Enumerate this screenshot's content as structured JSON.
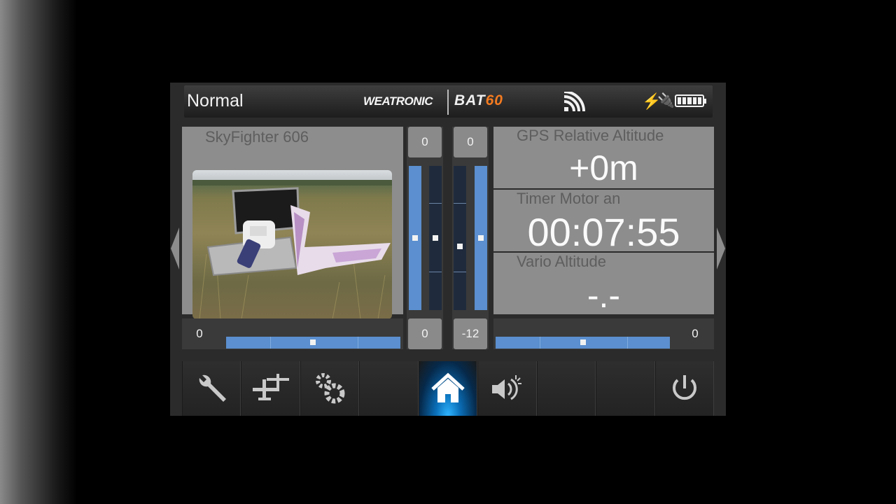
{
  "header": {
    "mode": "Normal",
    "brand": "WEATRONIC",
    "model_prefix": "BAT",
    "model_suffix": "60",
    "icons": [
      "signal-icon",
      "flash-icon",
      "plug-icon",
      "battery-icon"
    ]
  },
  "model": {
    "name": "SkyFighter 606"
  },
  "trims": {
    "col1_top": "0",
    "col2_top": "0",
    "bottom_left": "0",
    "bottom_mid_left": "0",
    "bottom_mid_right": "-12",
    "bottom_right": "0"
  },
  "telemetry": [
    {
      "label": "GPS Relative Altitude",
      "value": "+0m"
    },
    {
      "label": "Timer Motor an",
      "value": "00:07:55"
    },
    {
      "label": "Vario Altitude",
      "value": "-.-"
    }
  ],
  "nav": {
    "items": [
      "wrench-icon",
      "airplanes-icon",
      "gears-icon",
      "blank",
      "home-icon",
      "speaker-icon",
      "blank",
      "blank",
      "power-icon"
    ],
    "active": "home-icon"
  },
  "colors": {
    "accent_orange": "#f47b20",
    "bar_blue": "#5b8fcf",
    "active_nav": "#2fb4ff"
  }
}
